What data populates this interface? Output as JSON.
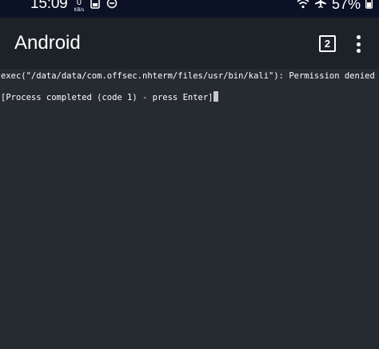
{
  "status_bar": {
    "time": "15:09",
    "net_speed_value": "0",
    "net_speed_unit": "KB/s",
    "battery_percent": "57%",
    "icons": [
      "net-speed",
      "screenshot-icon",
      "do-not-disturb-icon",
      "wifi-icon",
      "airplane-mode-icon",
      "battery-icon"
    ]
  },
  "app_bar": {
    "title": "Android",
    "session_count": "2",
    "colors": {
      "background": "#1d2128",
      "text": "#ffffff"
    }
  },
  "terminal": {
    "lines": [
      "exec(\"/data/data/com.offsec.nhterm/files/usr/bin/kali\"): Permission denied",
      "[Process completed (code 1) - press Enter]"
    ],
    "colors": {
      "background": "#262a31",
      "text": "#ffffff",
      "cursor": "#c8c8c8"
    }
  }
}
